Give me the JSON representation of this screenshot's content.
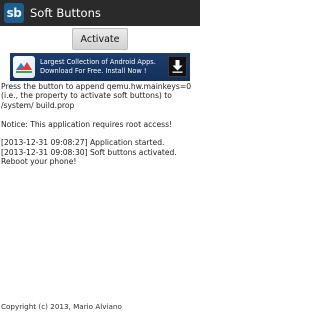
{
  "action_bar": {
    "icon_text": "sb",
    "title": "Soft Buttons"
  },
  "activate_button": {
    "label": "Activate"
  },
  "ad_banner": {
    "line1": "Largest Collection of Android Apps.",
    "line2": "Download For Free. Install Now !"
  },
  "content": {
    "description": "Press the button to append qemu.hw.mainkeys=0 (i.e., the property to activate soft buttons) to /system/ build.prop",
    "notice": "Notice: This application requires root access!",
    "log": [
      "[2013-12-31 09:08:27] Application started.",
      "[2013-12-31 09:08:30] Soft buttons activated. Reboot your phone!"
    ]
  },
  "footer": {
    "copyright": "Copyright (c) 2013, Mario Alviano"
  },
  "colors": {
    "action_bar": "#2a2a2a",
    "icon_bg": "#1b5e8e",
    "ad_bg": "#1c3d6e"
  }
}
